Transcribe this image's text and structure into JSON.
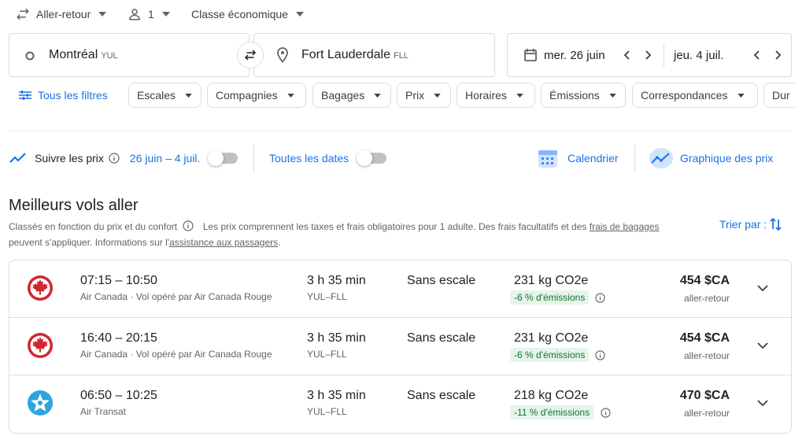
{
  "trip_options": {
    "trip_type": "Aller-retour",
    "passengers": "1",
    "cabin_class": "Classe économique"
  },
  "search": {
    "origin_city": "Montréal",
    "origin_code": "YUL",
    "destination_city": "Fort Lauderdale",
    "destination_code": "FLL",
    "depart_date": "mer. 26 juin",
    "return_date": "jeu. 4 juil."
  },
  "filters": {
    "all_filters": "Tous les filtres",
    "chips": [
      "Escales",
      "Compagnies",
      "Bagages",
      "Prix",
      "Horaires",
      "Émissions",
      "Correspondances",
      "Dur"
    ]
  },
  "tracking": {
    "track_prices_label": "Suivre les prix",
    "date_range": "26 juin – 4 juil.",
    "all_dates_label": "Toutes les dates",
    "calendar_label": "Calendrier",
    "price_graph_label": "Graphique des prix"
  },
  "results": {
    "heading": "Meilleurs vols aller",
    "note_part1": "Classés en fonction du prix et du confort",
    "note_part2": "Les prix comprennent les taxes et frais obligatoires pour 1 adulte. Des frais facultatifs et des",
    "note_link1": "frais de bagages",
    "note_part3": "peuvent s'appliquer. Informations sur l'",
    "note_link2": "assistance aux passagers",
    "note_part4": ".",
    "sort_label": "Trier par :",
    "flights": [
      {
        "times": "07:15 – 10:50",
        "airline": "Air Canada · Vol opéré par Air Canada Rouge",
        "logo": "air-canada-logo",
        "duration": "3 h 35 min",
        "route": "YUL–FLL",
        "stops": "Sans escale",
        "emissions": "231 kg CO2e",
        "emissions_badge": "-6 % d'émissions",
        "price": "454 $CA",
        "trip_type": "aller-retour"
      },
      {
        "times": "16:40 – 20:15",
        "airline": "Air Canada · Vol opéré par Air Canada Rouge",
        "logo": "air-canada-logo",
        "duration": "3 h 35 min",
        "route": "YUL–FLL",
        "stops": "Sans escale",
        "emissions": "231 kg CO2e",
        "emissions_badge": "-6 % d'émissions",
        "price": "454 $CA",
        "trip_type": "aller-retour"
      },
      {
        "times": "06:50 – 10:25",
        "airline": "Air Transat",
        "logo": "air-transat-logo",
        "duration": "3 h 35 min",
        "route": "YUL–FLL",
        "stops": "Sans escale",
        "emissions": "218 kg CO2e",
        "emissions_badge": "-11 % d'émissions",
        "price": "470 $CA",
        "trip_type": "aller-retour"
      }
    ]
  },
  "colors": {
    "accent_blue": "#1a73e8",
    "air_canada_red": "#d22630",
    "air_transat_blue": "#2ba6de",
    "emissions_badge_bg": "#e6f4ea",
    "emissions_badge_text": "#137333"
  }
}
